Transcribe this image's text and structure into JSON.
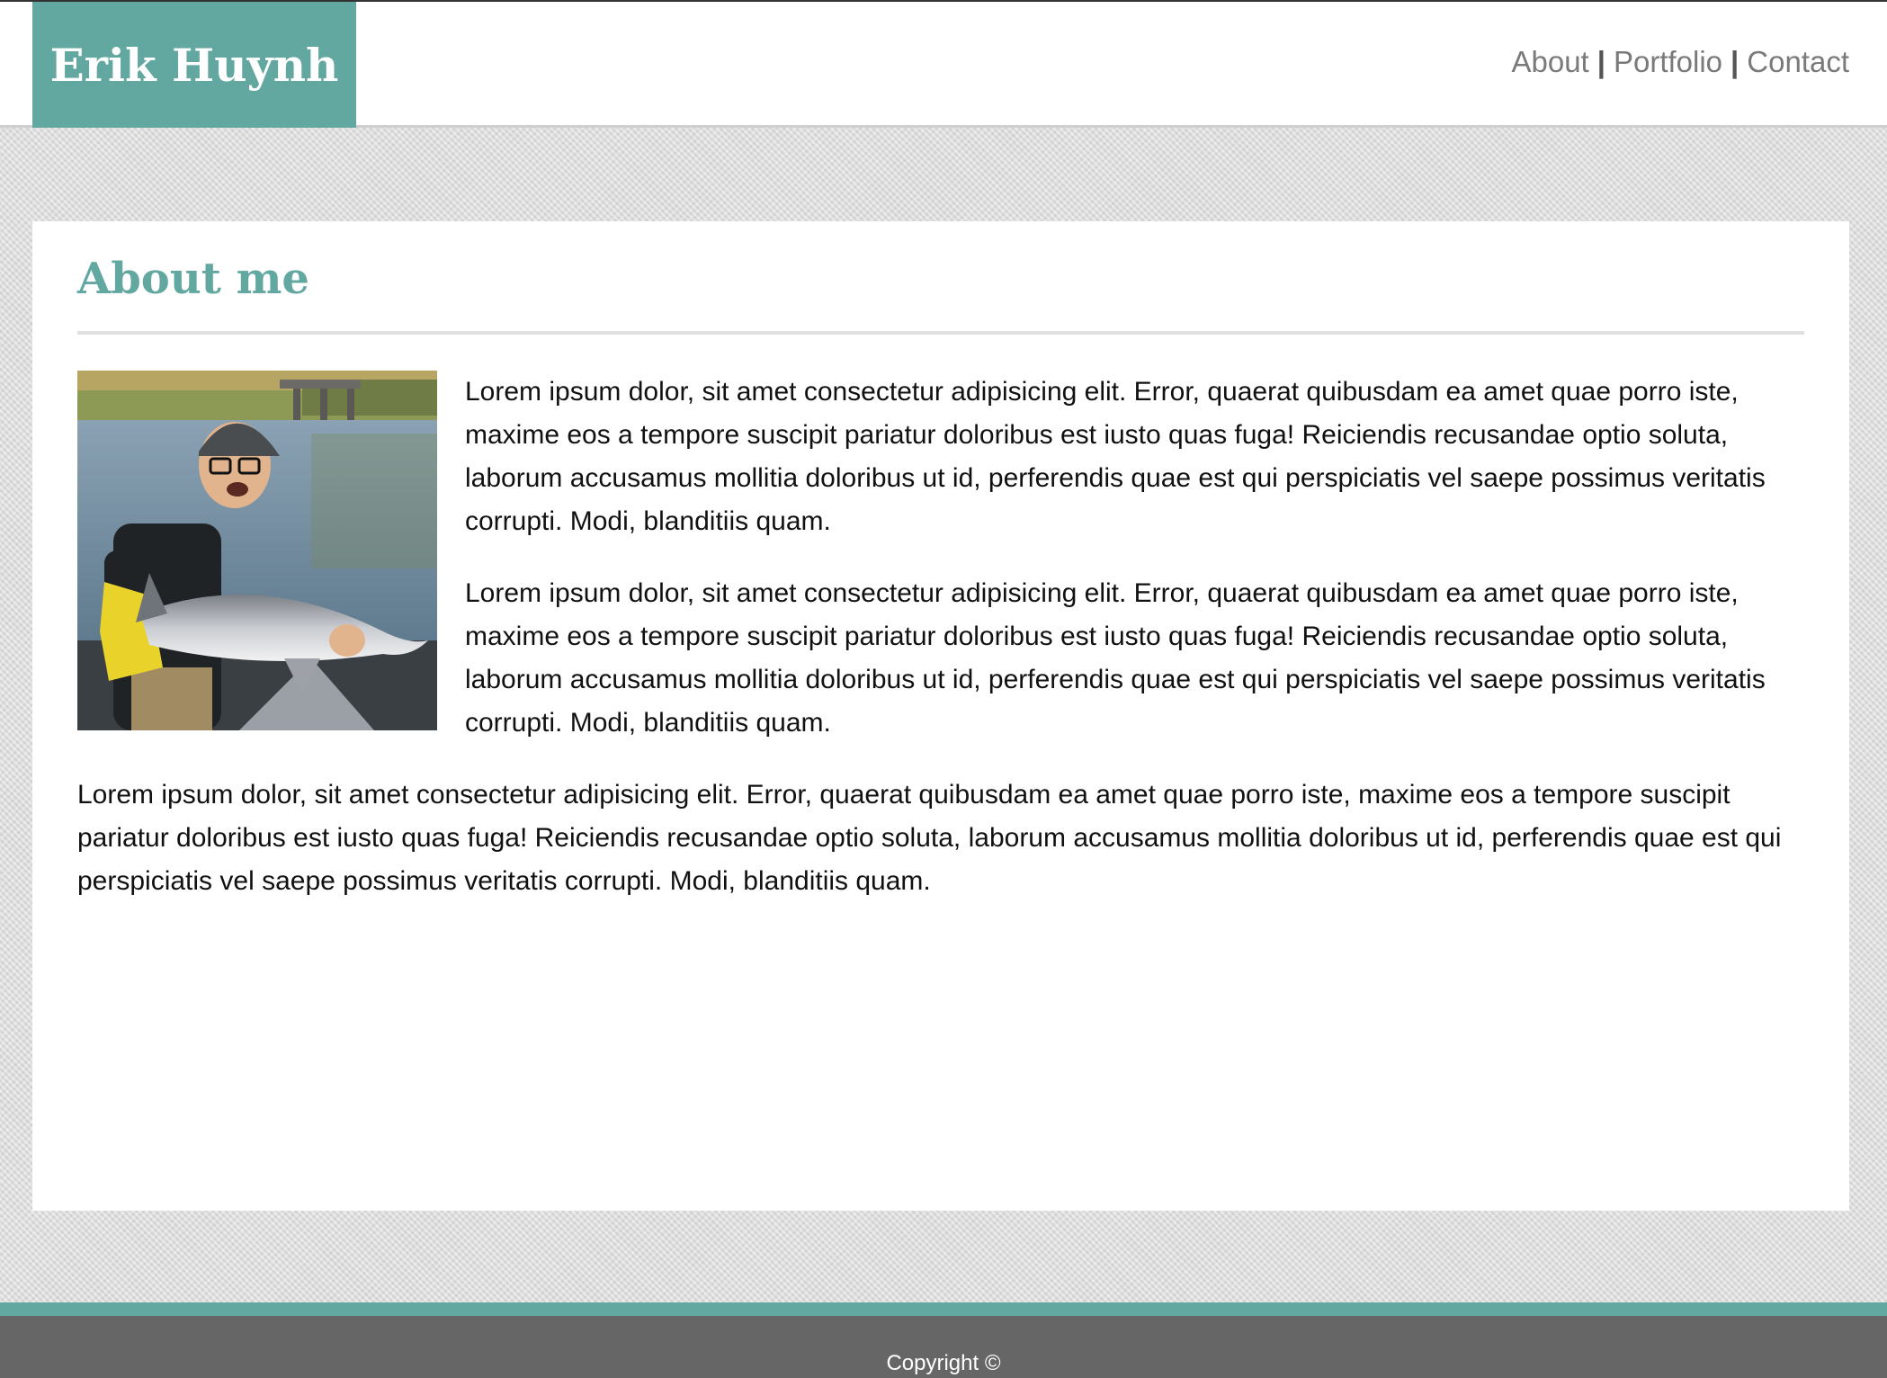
{
  "header": {
    "brand_name": "Erik Huynh",
    "nav": [
      {
        "label": "About"
      },
      {
        "label": "Portfolio"
      },
      {
        "label": "Contact"
      }
    ],
    "separator": "|"
  },
  "main": {
    "title": "About me",
    "photo_alt": "photo",
    "paragraphs": [
      "Lorem ipsum dolor, sit amet consectetur adipisicing elit. Error, quaerat quibusdam ea amet quae porro iste, maxime eos a tempore suscipit pariatur doloribus est iusto quas fuga! Reiciendis recusandae optio soluta, laborum accusamus mollitia doloribus ut id, perferendis quae est qui perspiciatis vel saepe possimus veritatis corrupti. Modi, blanditiis quam.",
      "Lorem ipsum dolor, sit amet consectetur adipisicing elit. Error, quaerat quibusdam ea amet quae porro iste, maxime eos a tempore suscipit pariatur doloribus est iusto quas fuga! Reiciendis recusandae optio soluta, laborum accusamus mollitia doloribus ut id, perferendis quae est qui perspiciatis vel saepe possimus veritatis corrupti. Modi, blanditiis quam.",
      "Lorem ipsum dolor, sit amet consectetur adipisicing elit. Error, quaerat quibusdam ea amet quae porro iste, maxime eos a tempore suscipit pariatur doloribus est iusto quas fuga! Reiciendis recusandae optio soluta, laborum accusamus mollitia doloribus ut id, perferendis quae est qui perspiciatis vel saepe possimus veritatis corrupti. Modi, blanditiis quam."
    ]
  },
  "footer": {
    "copyright": "Copyright ©"
  },
  "colors": {
    "accent": "#62a8a1",
    "footer_bg": "#666666",
    "nav_text": "#7a7a7a"
  }
}
